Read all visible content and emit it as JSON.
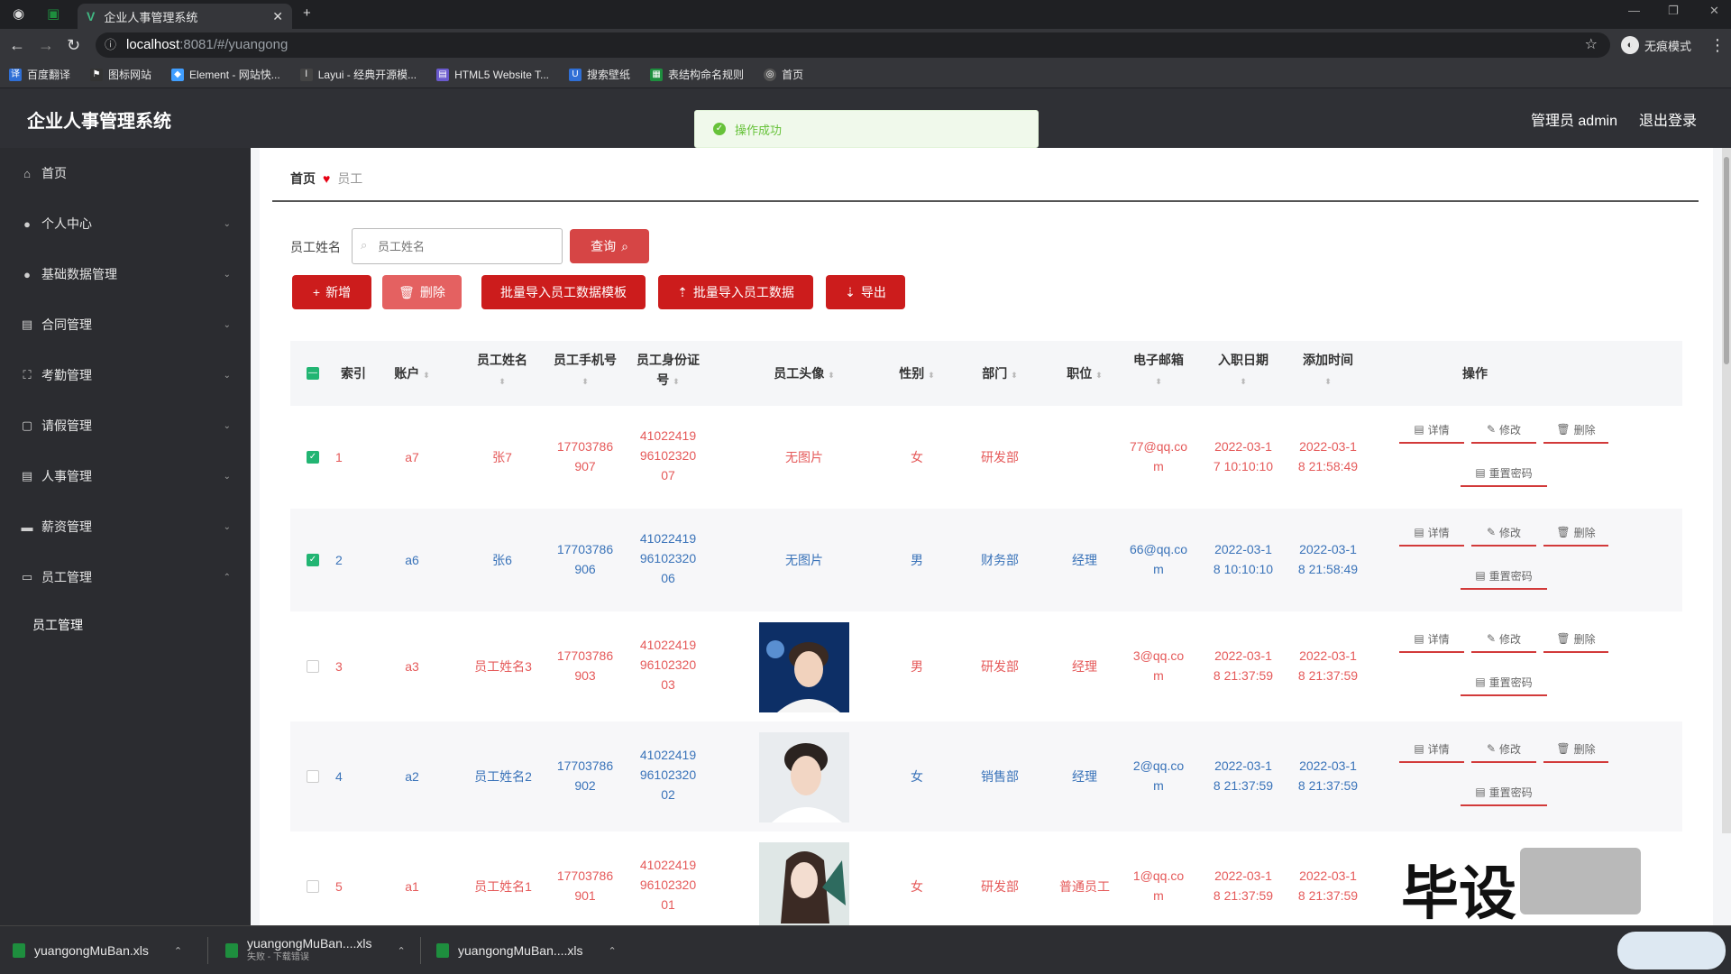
{
  "browser": {
    "tab_title": "企业人事管理系统",
    "url_host": "localhost",
    "url_path": ":8081/#/yuangong",
    "profile_label": "无痕模式",
    "bookmarks": [
      "百度翻译",
      "图标网站",
      "Element - 网站快...",
      "Layui - 经典开源模...",
      "HTML5 Website T...",
      "搜索壁纸",
      "表结构命名规则",
      "首页"
    ]
  },
  "app": {
    "title": "企业人事管理系统",
    "user_label": "管理员 admin",
    "logout_label": "退出登录"
  },
  "sidebar": {
    "items": [
      {
        "label": "首页",
        "icon": "home-icon"
      },
      {
        "label": "个人中心",
        "icon": "user-icon"
      },
      {
        "label": "基础数据管理",
        "icon": "user-icon"
      },
      {
        "label": "合同管理",
        "icon": "doc-icon"
      },
      {
        "label": "考勤管理",
        "icon": "frame-icon"
      },
      {
        "label": "请假管理",
        "icon": "doc-icon"
      },
      {
        "label": "人事管理",
        "icon": "doc-icon"
      },
      {
        "label": "薪资管理",
        "icon": "wallet-icon"
      },
      {
        "label": "员工管理",
        "icon": "chat-icon"
      }
    ],
    "sub_item": "员工管理"
  },
  "toast": {
    "text": "操作成功"
  },
  "breadcrumb": {
    "home": "首页",
    "current": "员工"
  },
  "search": {
    "label": "员工姓名",
    "placeholder": "员工姓名",
    "button": "查询"
  },
  "toolbar": {
    "add": "新增",
    "delete": "删除",
    "template": "批量导入员工数据模板",
    "import": "批量导入员工数据",
    "export": "导出"
  },
  "table": {
    "headers": {
      "index": "索引",
      "account": "账户",
      "name": "员工姓名",
      "phone": "员工手机号",
      "idcard_1": "员工身份证",
      "idcard_2": "号",
      "avatar": "员工头像",
      "gender": "性别",
      "dept": "部门",
      "position": "职位",
      "email": "电子邮箱",
      "hire": "入职日期",
      "added": "添加时间",
      "ops": "操作"
    },
    "rows": [
      {
        "idx": "1",
        "account": "a7",
        "name": "张7",
        "phone1": "17703786",
        "phone2": "907",
        "id1": "41022419",
        "id2": "96102320",
        "id3": "07",
        "avatar": "无图片",
        "gender": "女",
        "dept": "研发部",
        "position": "",
        "email1": "77@qq.co",
        "email2": "m",
        "hire1": "2022-03-1",
        "hire2": "7 10:10:10",
        "add1": "2022-03-1",
        "add2": "8 21:58:49",
        "checked": true
      },
      {
        "idx": "2",
        "account": "a6",
        "name": "张6",
        "phone1": "17703786",
        "phone2": "906",
        "id1": "41022419",
        "id2": "96102320",
        "id3": "06",
        "avatar": "无图片",
        "gender": "男",
        "dept": "财务部",
        "position": "经理",
        "email1": "66@qq.co",
        "email2": "m",
        "hire1": "2022-03-1",
        "hire2": "8 10:10:10",
        "add1": "2022-03-1",
        "add2": "8 21:58:49",
        "checked": true
      },
      {
        "idx": "3",
        "account": "a3",
        "name": "员工姓名3",
        "phone1": "17703786",
        "phone2": "903",
        "id1": "41022419",
        "id2": "96102320",
        "id3": "03",
        "avatar": "",
        "gender": "男",
        "dept": "研发部",
        "position": "经理",
        "email1": "3@qq.co",
        "email2": "m",
        "hire1": "2022-03-1",
        "hire2": "8 21:37:59",
        "add1": "2022-03-1",
        "add2": "8 21:37:59",
        "checked": false
      },
      {
        "idx": "4",
        "account": "a2",
        "name": "员工姓名2",
        "phone1": "17703786",
        "phone2": "902",
        "id1": "41022419",
        "id2": "96102320",
        "id3": "02",
        "avatar": "",
        "gender": "女",
        "dept": "销售部",
        "position": "经理",
        "email1": "2@qq.co",
        "email2": "m",
        "hire1": "2022-03-1",
        "hire2": "8 21:37:59",
        "add1": "2022-03-1",
        "add2": "8 21:37:59",
        "checked": false
      },
      {
        "idx": "5",
        "account": "a1",
        "name": "员工姓名1",
        "phone1": "17703786",
        "phone2": "901",
        "id1": "41022419",
        "id2": "96102320",
        "id3": "01",
        "avatar": "",
        "gender": "女",
        "dept": "研发部",
        "position": "普通员工",
        "email1": "1@qq.co",
        "email2": "m",
        "hire1": "2022-03-1",
        "hire2": "8 21:37:59",
        "add1": "2022-03-1",
        "add2": "8 21:37:59",
        "checked": false
      }
    ],
    "ops": {
      "detail": "详情",
      "edit": "修改",
      "delete": "删除",
      "reset": "重置密码"
    }
  },
  "downloads": [
    {
      "name": "yuangongMuBan.xls",
      "status": ""
    },
    {
      "name": "yuangongMuBan....xls",
      "status": "失败 - 下载错误"
    },
    {
      "name": "yuangongMuBan....xls",
      "status": ""
    }
  ],
  "watermark": "毕设",
  "colors": {
    "primary_red": "#cc1c1c",
    "success_green": "#67c23a",
    "link_blue": "#3a73b9",
    "text_red": "#e55a5a"
  }
}
